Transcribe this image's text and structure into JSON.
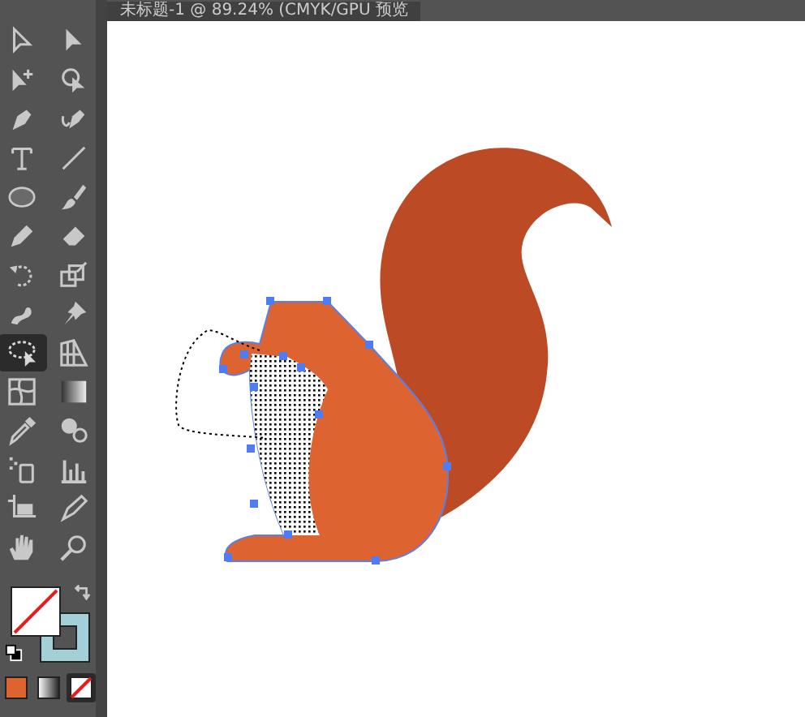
{
  "document_tab": {
    "title": "未标题-1 @ 89.24% (CMYK/GPU 预览"
  },
  "tools": [
    {
      "kind": "direct-select",
      "selected": false
    },
    {
      "kind": "select",
      "selected": false
    },
    {
      "kind": "add-select",
      "selected": false
    },
    {
      "kind": "lasso-select",
      "selected": false
    },
    {
      "kind": "pen",
      "selected": false
    },
    {
      "kind": "curve-pen",
      "selected": false
    },
    {
      "kind": "type",
      "selected": false
    },
    {
      "kind": "line",
      "selected": false
    },
    {
      "kind": "ellipse",
      "selected": false
    },
    {
      "kind": "brush",
      "selected": false
    },
    {
      "kind": "pencil",
      "selected": false
    },
    {
      "kind": "eraser",
      "selected": false
    },
    {
      "kind": "rotate",
      "selected": false
    },
    {
      "kind": "scale",
      "selected": false
    },
    {
      "kind": "warp",
      "selected": false
    },
    {
      "kind": "pin",
      "selected": false
    },
    {
      "kind": "lasso",
      "selected": true
    },
    {
      "kind": "grid",
      "selected": false
    },
    {
      "kind": "mesh",
      "selected": false
    },
    {
      "kind": "gradient",
      "selected": false
    },
    {
      "kind": "eyedropper",
      "selected": false
    },
    {
      "kind": "shapes",
      "selected": false
    },
    {
      "kind": "sprayer",
      "selected": false
    },
    {
      "kind": "graph",
      "selected": false
    },
    {
      "kind": "artboard",
      "selected": false
    },
    {
      "kind": "knife",
      "selected": false
    },
    {
      "kind": "hand",
      "selected": false
    },
    {
      "kind": "zoom",
      "selected": false
    }
  ],
  "fill_stroke": {
    "fill": {
      "none": true
    },
    "stroke": {
      "color": "#a3d0d8"
    }
  },
  "color_modes": [
    {
      "kind": "color",
      "color": "#dd6431",
      "selected": false
    },
    {
      "kind": "gradient",
      "selected": false
    },
    {
      "kind": "none",
      "selected": true
    }
  ]
}
